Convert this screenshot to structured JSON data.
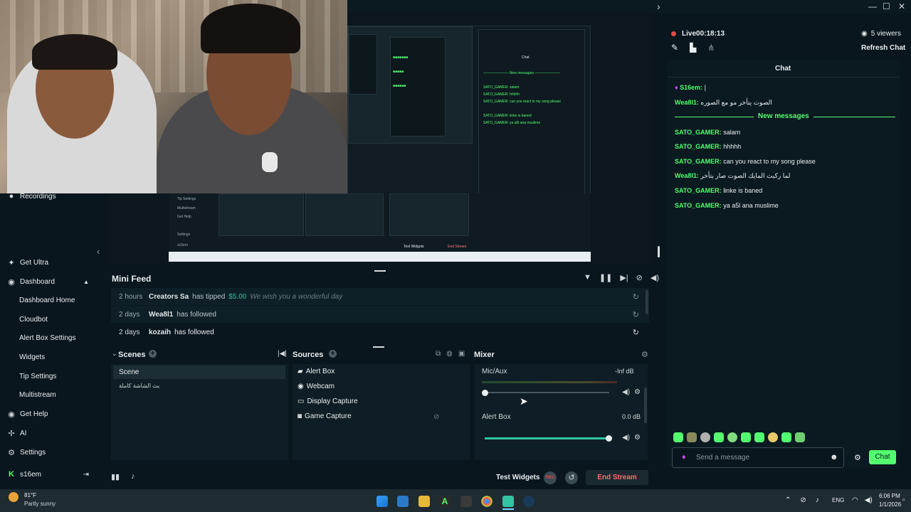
{
  "window": {
    "min": "—",
    "max": "☐",
    "close": "✕",
    "expand": "›"
  },
  "sidebar": {
    "recordings": "Recordings",
    "get_ultra": "Get Ultra",
    "dashboard": "Dashboard",
    "dashboard_sub": [
      "Dashboard Home",
      "Cloudbot",
      "Alert Box Settings",
      "Widgets",
      "Tip Settings",
      "Multistream"
    ],
    "get_help": "Get Help",
    "ai": "AI",
    "settings": "Settings",
    "user": "s16em"
  },
  "mini_feed": {
    "title": "Mini Feed",
    "rows": [
      {
        "time": "2 hours",
        "who": "Creators Sa",
        "action": "has tipped",
        "amount": "$5.00",
        "message": "We wish you a wonderful day"
      },
      {
        "time": "2 days",
        "who": "Wea8l1",
        "action": "has followed",
        "amount": "",
        "message": ""
      },
      {
        "time": "2 days",
        "who": "kozaih",
        "action": "has followed",
        "amount": "",
        "message": ""
      }
    ]
  },
  "scenes": {
    "title": "Scenes",
    "items": [
      "Scene",
      "بث الشاشة كاملة"
    ]
  },
  "sources": {
    "title": "Sources",
    "items": [
      "Alert Box",
      "Webcam",
      "Display Capture",
      "Game Capture"
    ]
  },
  "mixer": {
    "title": "Mixer",
    "channels": [
      {
        "name": "Mic/Aux",
        "level": "-Inf dB",
        "volume": 0.0
      },
      {
        "name": "Alert Box",
        "level": "0.0 dB",
        "volume": 1.0
      }
    ]
  },
  "bottom": {
    "test_widgets": "Test Widgets",
    "rec": "REC",
    "end_stream": "End Stream"
  },
  "chat": {
    "live": "Live",
    "timer": "00:18:13",
    "viewers": "5 viewers",
    "refresh": "Refresh Chat",
    "header": "Chat",
    "new_messages": "New messages",
    "pinned": [
      {
        "user": "S16em:",
        "text": "|"
      },
      {
        "user": "Wea8l1:",
        "text": "الصوت يتأخر مو مع الصوره"
      }
    ],
    "messages": [
      {
        "user": "SATO_GAMER:",
        "text": "salam"
      },
      {
        "user": "SATO_GAMER:",
        "text": "hhhhh"
      },
      {
        "user": "SATO_GAMER:",
        "text": "can you react to my song please"
      },
      {
        "user": "Wea8l1:",
        "text": "لما ركبت المايك الصوت صار يتأخر"
      },
      {
        "user": "SATO_GAMER:",
        "text": "linke is baned"
      },
      {
        "user": "SATO_GAMER:",
        "text": "ya a5l ana muslime"
      }
    ],
    "input_placeholder": "Send a message",
    "send": "Chat"
  },
  "taskbar": {
    "weather_temp": "81°F",
    "weather_desc": "Partly sunny",
    "lang": "ENG",
    "time": "6:06 PM",
    "date": "1/1/2026"
  },
  "colors": {
    "accent": "#53ff6f",
    "bg": "#09161d",
    "panel": "#0f1e26",
    "live": "#e24a4a"
  }
}
